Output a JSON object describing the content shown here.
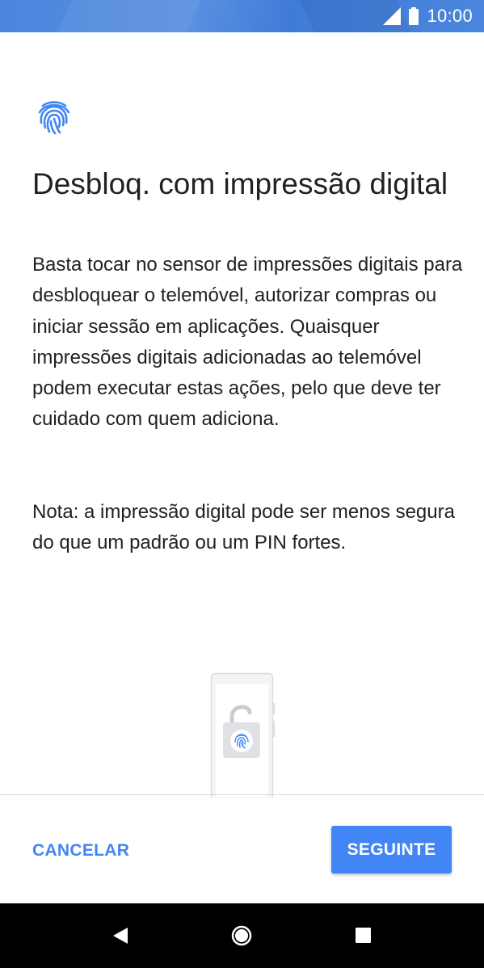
{
  "status_bar": {
    "time": "10:00",
    "icons": [
      "signal-icon",
      "battery-icon"
    ],
    "background": "#4a86dd"
  },
  "header": {
    "icon": "fingerprint-icon",
    "title": "Desbloq. com impressão digital"
  },
  "main": {
    "description": "Basta tocar no sensor de impressões digitais para desbloquear o telemóvel, autorizar compras ou iniciar sessão em aplicações. Quaisquer impressões digitais adicionadas ao telemóvel podem executar estas ações, pelo que deve ter cuidado com quem adiciona.",
    "note": "Nota: a impressão digital pode ser menos segura do que um padrão ou um PIN fortes.",
    "illustration": "phone-with-fingerprint-unlock-illustration"
  },
  "footer": {
    "cancel_label": "CANCELAR",
    "next_label": "SEGUINTE"
  },
  "nav_bar": {
    "icons": [
      "back-icon",
      "home-icon",
      "recents-icon"
    ]
  },
  "colors": {
    "accent": "#4285f4",
    "text": "#202124",
    "divider": "#dadce0"
  }
}
